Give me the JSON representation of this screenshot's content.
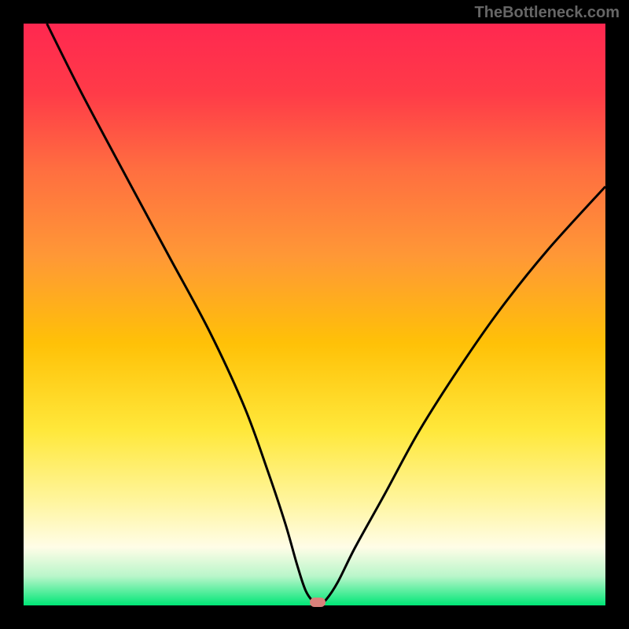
{
  "watermark": "TheBottleneck.com",
  "chart_data": {
    "type": "line",
    "title": "",
    "xlabel": "",
    "ylabel": "",
    "xlim": [
      0,
      100
    ],
    "ylim": [
      0,
      100
    ],
    "background_gradient": {
      "stops": [
        {
          "pos": 0,
          "color": "#ff1744"
        },
        {
          "pos": 25,
          "color": "#ff6e40"
        },
        {
          "pos": 50,
          "color": "#ffc107"
        },
        {
          "pos": 70,
          "color": "#ffeb3b"
        },
        {
          "pos": 85,
          "color": "#fff59d"
        },
        {
          "pos": 92,
          "color": "#fffde7"
        },
        {
          "pos": 96,
          "color": "#b9f6ca"
        },
        {
          "pos": 100,
          "color": "#00e676"
        }
      ]
    },
    "series": [
      {
        "name": "bottleneck-curve",
        "color": "#000000",
        "x": [
          4,
          10,
          18,
          25,
          32,
          38,
          42,
          45,
          47,
          48.5,
          50,
          51,
          52,
          54,
          57,
          62,
          68,
          75,
          82,
          90,
          100
        ],
        "values": [
          100,
          88,
          73,
          60,
          47,
          34,
          23,
          14,
          7,
          2.5,
          0.5,
          0.5,
          1,
          4,
          10,
          19,
          30,
          41,
          51,
          61,
          72
        ]
      }
    ],
    "marker": {
      "x": 50.5,
      "y": 0.5,
      "color": "#d9817b"
    }
  }
}
